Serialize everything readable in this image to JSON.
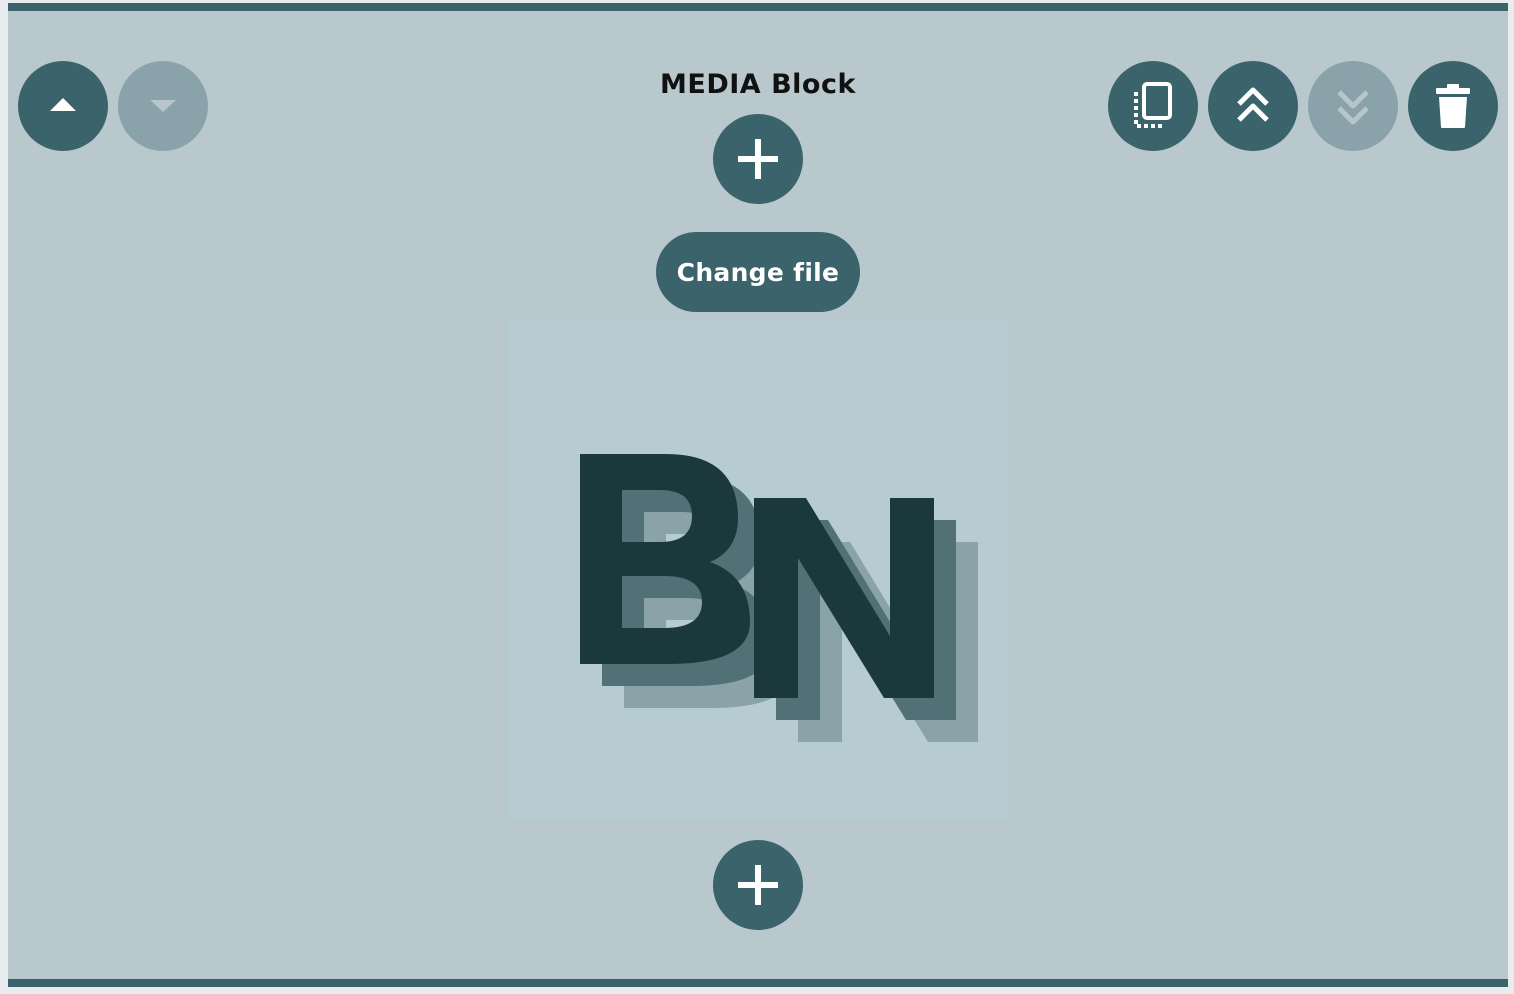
{
  "block": {
    "title": "MEDIA Block",
    "change_file_label": "Change file"
  },
  "controls": {
    "move_up": {
      "icon": "caret-up-icon",
      "enabled": true
    },
    "move_down": {
      "icon": "caret-down-icon",
      "enabled": false
    },
    "duplicate": {
      "icon": "duplicate-icon",
      "enabled": true
    },
    "move_to_top": {
      "icon": "double-chevron-up-icon",
      "enabled": true
    },
    "move_to_bottom": {
      "icon": "double-chevron-down-icon",
      "enabled": false
    },
    "delete": {
      "icon": "trash-icon",
      "enabled": true
    },
    "add_above": {
      "icon": "plus-icon",
      "enabled": true
    },
    "add_below": {
      "icon": "plus-icon",
      "enabled": true
    }
  },
  "media": {
    "logo_text": "BN"
  },
  "colors": {
    "accent": "#3b636b",
    "disabled": "#8aa3aa",
    "block_bg": "#b9c8cd",
    "media_bg": "#b6cbd2",
    "logo_dark": "#1b393d"
  }
}
